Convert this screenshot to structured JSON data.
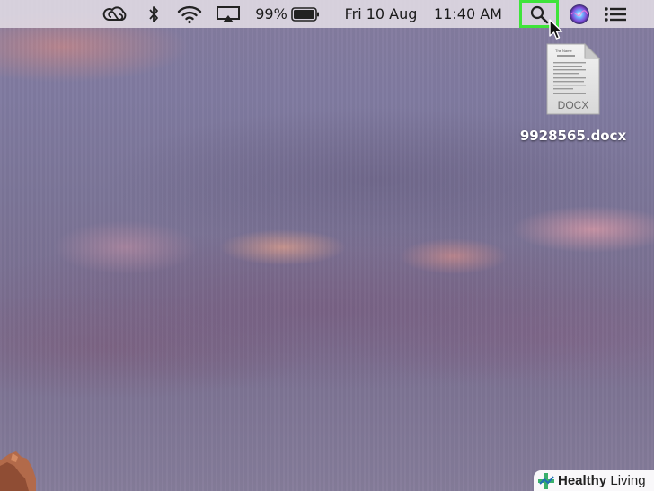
{
  "menubar": {
    "battery_percent": "99%",
    "battery_level": 0.99,
    "date": "Fri 10 Aug",
    "time": "11:40 AM",
    "status_icons": [
      "creative-cloud-icon",
      "bluetooth-icon",
      "wifi-icon",
      "airplay-icon",
      "battery-icon",
      "spotlight-search-icon",
      "siri-icon",
      "notification-center-icon"
    ],
    "highlight_color": "#3ee43a"
  },
  "desktop": {
    "file": {
      "name": "9928565.docx",
      "type_label": "DOCX",
      "doc_title": "The Name"
    }
  },
  "watermark": {
    "word1": "Healthy",
    "word2": "Living",
    "brand_color": "#3ab06b"
  }
}
